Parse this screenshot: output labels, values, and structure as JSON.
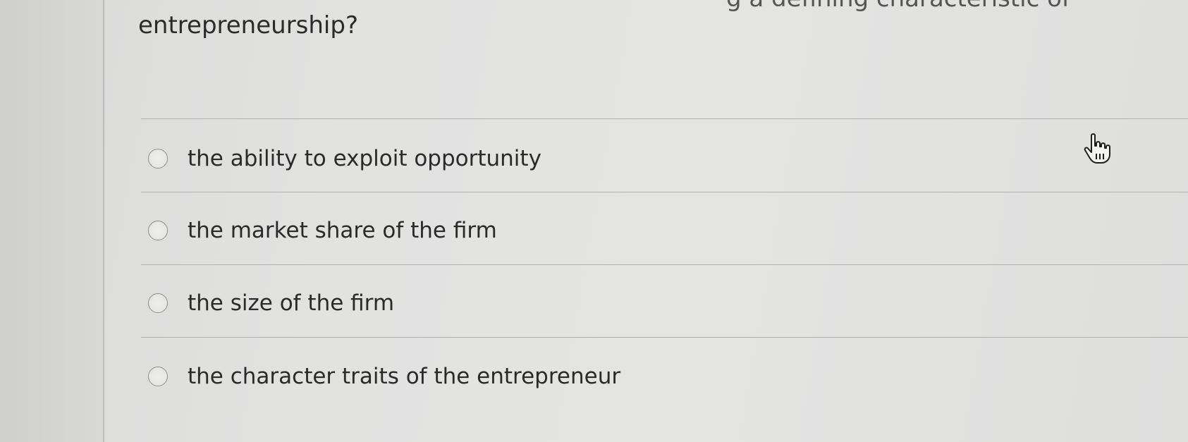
{
  "header_clipped": "g a defining characteristic of",
  "question": "entrepreneurship?",
  "options": [
    {
      "label": "the ability to exploit opportunity"
    },
    {
      "label": "the market share of the firm"
    },
    {
      "label": "the size of the firm"
    },
    {
      "label": "the character traits of the entrepreneur"
    }
  ],
  "cursor": {
    "icon": "hand-pointer-icon"
  }
}
